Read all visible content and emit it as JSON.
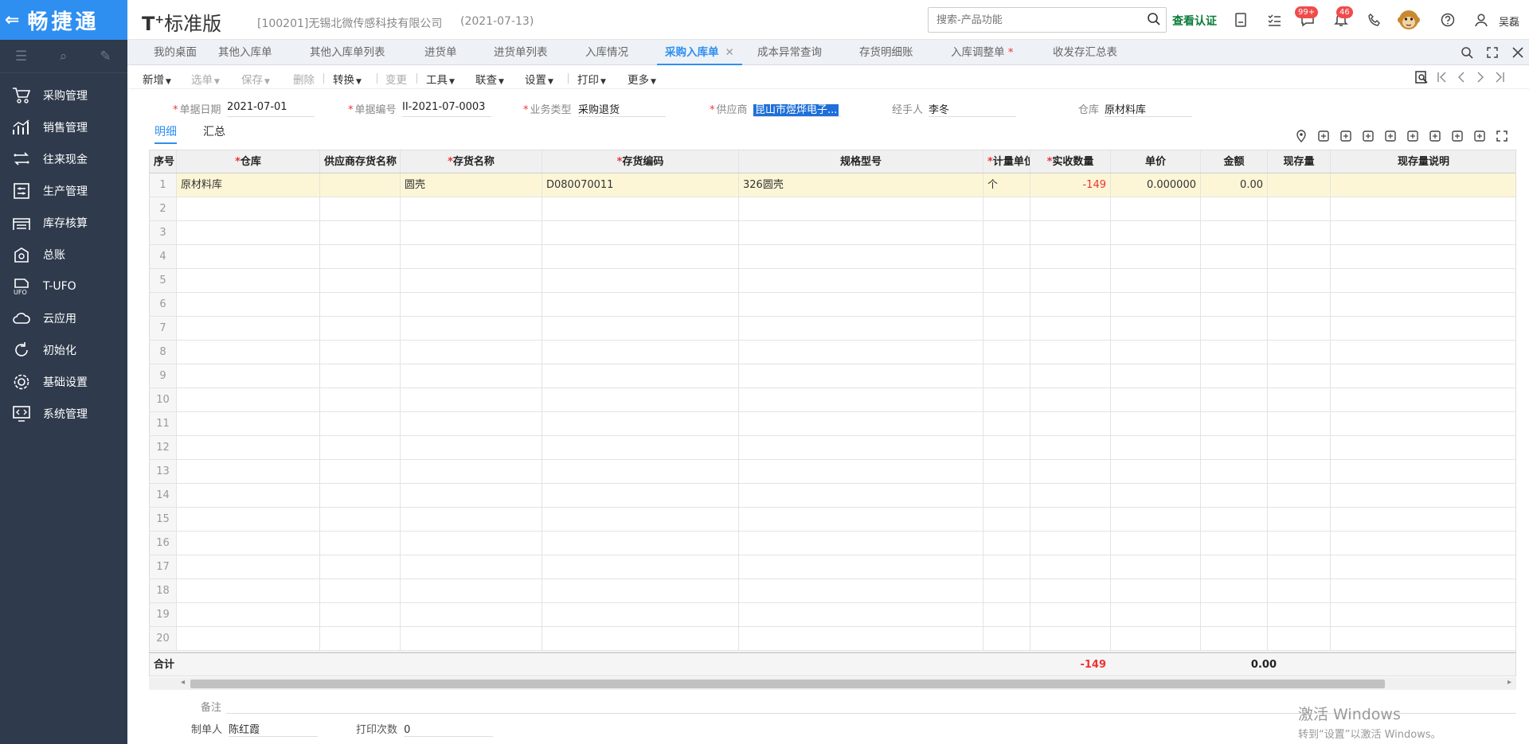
{
  "brand": {
    "title": "畅捷通"
  },
  "header": {
    "logo_main": "T",
    "logo_plus": "+",
    "logo_text": "标准版",
    "company": "[100201]无锡北微传感科技有限公司",
    "date": "(2021-07-13)",
    "search_placeholder": "搜索-产品功能",
    "cert_label": "查看认证",
    "msg_badge": "99+",
    "bell_badge": "46",
    "user": "吴磊"
  },
  "sidebar": {
    "items": [
      {
        "label": "采购管理",
        "icon": "cart-icon"
      },
      {
        "label": "销售管理",
        "icon": "chart-icon"
      },
      {
        "label": "往来现金",
        "icon": "exchange-icon"
      },
      {
        "label": "生产管理",
        "icon": "production-icon"
      },
      {
        "label": "库存核算",
        "icon": "inventory-icon"
      },
      {
        "label": "总账",
        "icon": "ledger-icon"
      },
      {
        "label": "T-UFO",
        "icon": "ufo-icon"
      },
      {
        "label": "云应用",
        "icon": "cloud-icon"
      },
      {
        "label": "初始化",
        "icon": "refresh-icon"
      },
      {
        "label": "基础设置",
        "icon": "settings-icon"
      },
      {
        "label": "系统管理",
        "icon": "system-icon"
      }
    ]
  },
  "tabs": [
    {
      "label": "我的桌面"
    },
    {
      "label": "其他入库单"
    },
    {
      "label": "其他入库单列表"
    },
    {
      "label": "进货单"
    },
    {
      "label": "进货单列表"
    },
    {
      "label": "入库情况"
    },
    {
      "label": "采购入库单",
      "active": true
    },
    {
      "label": "成本异常查询"
    },
    {
      "label": "存货明细账"
    },
    {
      "label": "入库调整单",
      "modified": "*"
    },
    {
      "label": "收发存汇总表"
    }
  ],
  "toolbar": {
    "new": "新增",
    "pick": "选单",
    "save": "保存",
    "delete": "删除",
    "convert": "转换",
    "change": "变更",
    "tools": "工具",
    "link": "联查",
    "settings": "设置",
    "print": "打印",
    "more": "更多"
  },
  "form": {
    "date_label": "单据日期",
    "date_value": "2021-07-01",
    "no_label": "单据编号",
    "no_value": "II-2021-07-0003",
    "biz_label": "业务类型",
    "biz_value": "采购退货",
    "supplier_label": "供应商",
    "supplier_value": "昆山市煜烨电子...",
    "handler_label": "经手人",
    "handler_value": "李冬",
    "warehouse_label": "仓库",
    "warehouse_value": "原材料库"
  },
  "subtabs": {
    "detail": "明细",
    "summary": "汇总"
  },
  "table": {
    "headers": [
      "序号",
      "仓库",
      "供应商存货名称",
      "存货名称",
      "存货编码",
      "规格型号",
      "计量单位",
      "实收数量",
      "单价",
      "金额",
      "现存量",
      "现存量说明"
    ],
    "required": [
      false,
      true,
      false,
      true,
      true,
      false,
      true,
      true,
      false,
      false,
      false,
      false
    ],
    "rows": [
      {
        "idx": "1",
        "warehouse": "原材料库",
        "supplier_name": "",
        "name": "圆壳",
        "code": "D080070011",
        "spec": "326圆壳",
        "unit": "个",
        "qty": "-149",
        "price": "0.000000",
        "amount": "0.00"
      }
    ],
    "empty_rows": [
      "2",
      "3",
      "4",
      "5",
      "6",
      "7",
      "8",
      "9",
      "10",
      "11",
      "12",
      "13",
      "14",
      "15",
      "16",
      "17",
      "18",
      "19",
      "20"
    ],
    "total_label": "合计",
    "total_qty": "-149",
    "total_amount": "0.00"
  },
  "footer": {
    "remark_label": "备注",
    "maker_label": "制单人",
    "maker_value": "陈红霞",
    "print_label": "打印次数",
    "print_value": "0"
  },
  "watermark": {
    "line1": "激活 Windows",
    "line2": "转到“设置”以激活 Windows。"
  }
}
